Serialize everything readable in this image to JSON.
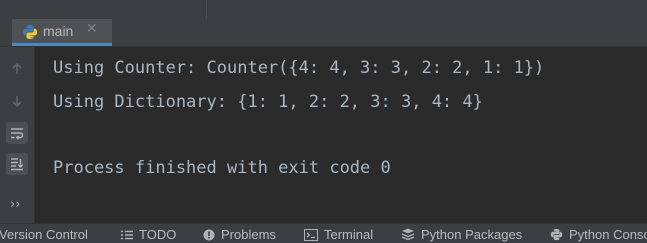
{
  "tab": {
    "label": "main",
    "close_glyph": "✕",
    "icon": "python-icon"
  },
  "gutter": {
    "buttons": [
      "rerun-up-icon",
      "rerun-down-icon",
      "soft-wrap-icon",
      "scroll-to-end-icon"
    ],
    "more_glyph": "››"
  },
  "console": {
    "lines": [
      "Using Counter: Counter({4: 4, 3: 3, 2: 2, 1: 1})",
      "Using Dictionary: {1: 1, 2: 2, 3: 3, 4: 4}",
      "",
      "Process finished with exit code 0"
    ]
  },
  "bottom_bar": {
    "items": [
      {
        "label": "Version Control",
        "icon": ""
      },
      {
        "label": "TODO",
        "icon": "list-icon"
      },
      {
        "label": "Problems",
        "icon": "problems-icon"
      },
      {
        "label": "Terminal",
        "icon": "terminal-icon"
      },
      {
        "label": "Python Packages",
        "icon": "packages-icon"
      },
      {
        "label": "Python Conso",
        "icon": "python-console-icon"
      }
    ]
  },
  "colors": {
    "background": "#2b2b2b",
    "panel": "#3c3f41",
    "text": "#a9b7c6",
    "tab_active": "#4e5254",
    "tab_underline": "#4a88c7"
  }
}
